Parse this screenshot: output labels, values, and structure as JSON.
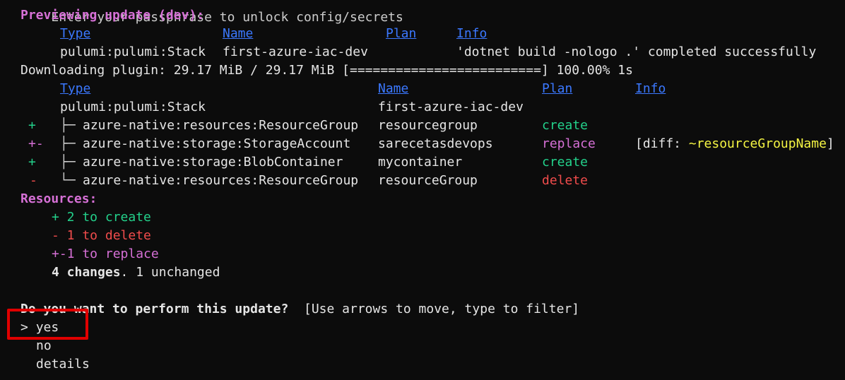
{
  "top_partial": "Enter your passphrase to unlock config/secrets",
  "preview_header": "Previewing update (dev):",
  "table1": {
    "headers": {
      "type": "Type",
      "name": "Name",
      "plan": "Plan",
      "info": "Info"
    },
    "row": {
      "type": "pulumi:pulumi:Stack",
      "name": "first-azure-iac-dev",
      "info": "'dotnet build -nologo .' completed successfully"
    }
  },
  "download_line": "Downloading plugin: 29.17 MiB / 29.17 MiB [=========================] 100.00% 1s",
  "table2": {
    "headers": {
      "type": "Type",
      "name": "Name",
      "plan": "Plan",
      "info": "Info"
    },
    "stack_row": {
      "type": "pulumi:pulumi:Stack",
      "name": "first-azure-iac-dev"
    },
    "rows": [
      {
        "op": "+",
        "tree": "├─",
        "type": "azure-native:resources:ResourceGroup",
        "name": "resourcegroup",
        "plan": "create",
        "info": ""
      },
      {
        "op": "+-",
        "tree": "├─",
        "type": "azure-native:storage:StorageAccount",
        "name": "sarecetasdevops",
        "plan": "replace",
        "info_prefix": "[diff: ",
        "info_value": "~resourceGroupName",
        "info_suffix": "]"
      },
      {
        "op": "+",
        "tree": "├─",
        "type": "azure-native:storage:BlobContainer",
        "name": "mycontainer",
        "plan": "create",
        "info": ""
      },
      {
        "op": "-",
        "tree": "└─",
        "type": "azure-native:resources:ResourceGroup",
        "name": "resourceGroup",
        "plan": "delete",
        "info": ""
      }
    ]
  },
  "resources": {
    "label": "Resources:",
    "create": "+ 2 to create",
    "delete": "- 1 to delete",
    "replace": "+-1 to replace",
    "changes_bold": "4 changes",
    "changes_rest": ". 1 unchanged"
  },
  "prompt": {
    "question": "Do you want to perform this update?",
    "hint": "[Use arrows to move, type to filter]",
    "cursor": ">",
    "options": [
      "yes",
      "no",
      "details"
    ],
    "selected": "yes"
  },
  "colors": {
    "background": "#0c0c0c",
    "text": "#cccccc",
    "magenta": "#d670d6",
    "green": "#23d18b",
    "red": "#f14c4c",
    "yellow": "#f5f543",
    "link_blue": "#3b78ff",
    "annotation_red": "#e00000"
  }
}
